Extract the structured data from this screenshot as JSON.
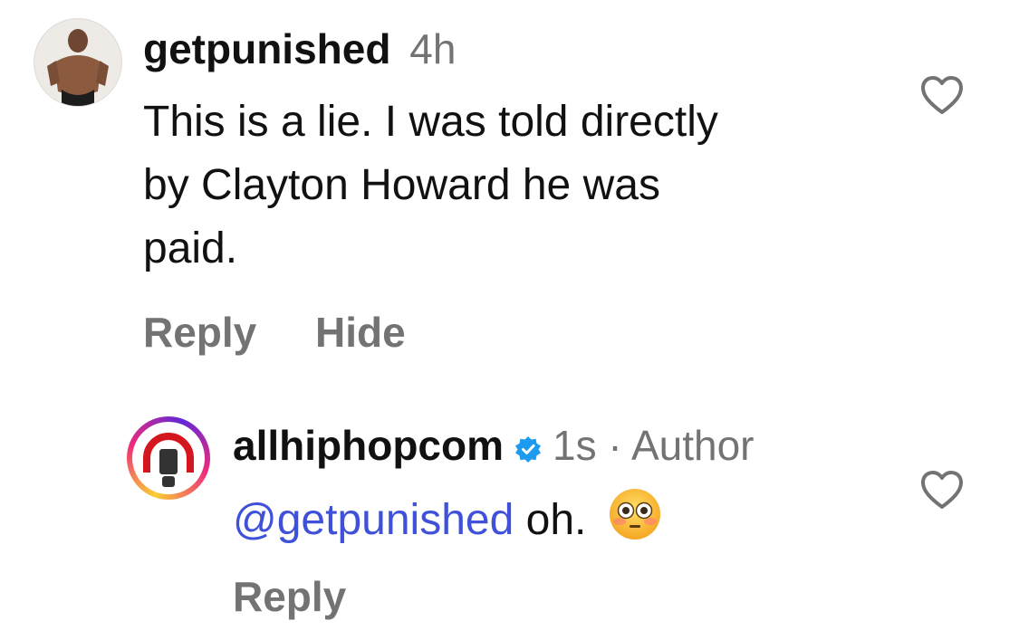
{
  "comments": [
    {
      "username": "getpunished",
      "time": "4h",
      "text_lines": [
        "This is a lie. I was told directly",
        "by Clayton Howard he was",
        "paid."
      ],
      "actions": [
        "Reply",
        "Hide"
      ]
    },
    {
      "username": "allhiphopcom",
      "verified": true,
      "time": "1s",
      "separator": "·",
      "author_label": "Author",
      "mention": "@getpunished",
      "text": "oh.",
      "emoji": "flushed-face",
      "actions": [
        "Reply"
      ]
    }
  ],
  "colors": {
    "mention": "#3f51d9",
    "meta": "#737373",
    "verified": "#1d9bf0"
  }
}
